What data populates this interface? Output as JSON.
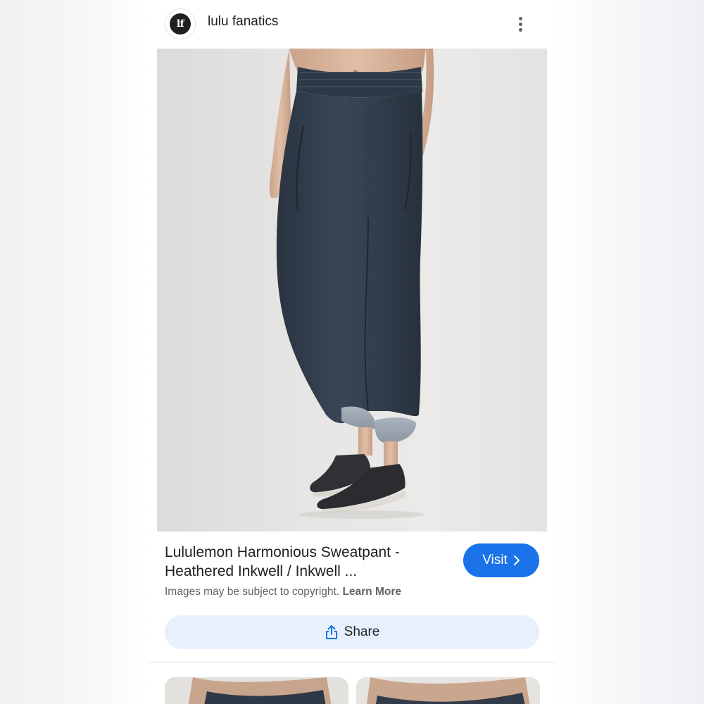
{
  "header": {
    "site_name": "lulu fanatics",
    "avatar_text": "lf"
  },
  "main_image": {
    "alt": "lululemon harmonious sweatpant product photo"
  },
  "result": {
    "title_line1": "Lululemon Harmonious Sweatpant -",
    "title_line2": "Heathered Inkwell / Inkwell ...",
    "visit_label": "Visit",
    "copyright_text": "Images may be subject to copyright.",
    "learn_more_label": "Learn More",
    "share_label": "Share"
  },
  "colors": {
    "accent": "#1a73e8",
    "share_bg": "#e8f0fe",
    "text": "#202124",
    "muted": "#5f6368"
  },
  "icons": {
    "more": "more-vert-icon",
    "visit": "chevron-right-icon",
    "share": "share-icon"
  }
}
